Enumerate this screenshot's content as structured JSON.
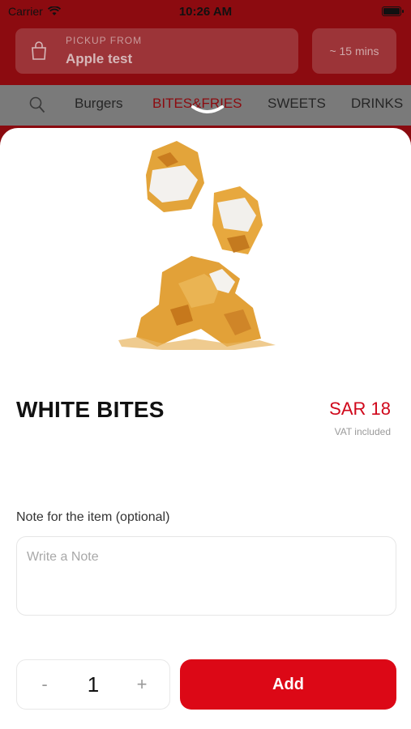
{
  "status_bar": {
    "carrier": "Carrier",
    "time": "10:26 AM"
  },
  "header": {
    "pickup_label": "PICKUP FROM",
    "pickup_store": "Apple test",
    "eta": "~ 15 mins"
  },
  "tabs": [
    {
      "label": "Burgers",
      "active": false
    },
    {
      "label": "BITES&FRIES",
      "active": true
    },
    {
      "label": "SWEETS",
      "active": false
    },
    {
      "label": "DRINKS",
      "active": false
    }
  ],
  "item": {
    "name": "WHITE BITES",
    "price": "SAR 18",
    "vat_note": "VAT included"
  },
  "note": {
    "label": "Note for the item (optional)",
    "placeholder": "Write a Note"
  },
  "quantity": {
    "minus": "-",
    "value": "1",
    "plus": "+"
  },
  "actions": {
    "add_label": "Add"
  },
  "colors": {
    "brand_red": "#dc0816",
    "price_red": "#d0081b",
    "header_dim": "#8c0b10"
  }
}
